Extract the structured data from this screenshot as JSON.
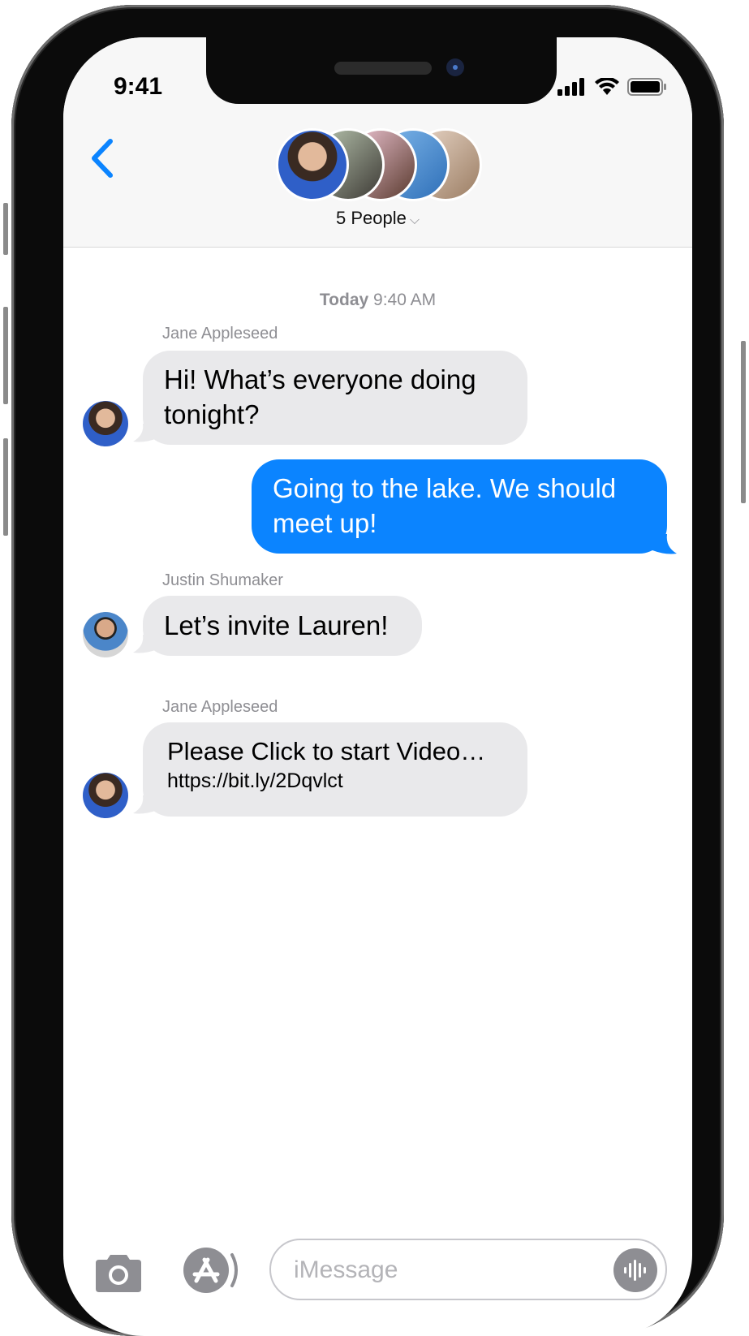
{
  "status_bar": {
    "time": "9:41",
    "icons": [
      "cellular-signal-icon",
      "wifi-icon",
      "battery-icon"
    ]
  },
  "header": {
    "back_icon": "chevron-left-icon",
    "group_label": "5 People",
    "group_chevron": "⌵",
    "avatar_count": 5
  },
  "conversation": {
    "timestamp_day": "Today",
    "timestamp_time": "9:40 AM",
    "messages": [
      {
        "sender": "Jane Appleseed",
        "direction": "incoming",
        "text_lines": [
          "Hi! What’s everyone doing",
          "tonight?"
        ]
      },
      {
        "sender": "",
        "direction": "outgoing",
        "text_lines": [
          "Going to the lake. We should",
          "meet up!"
        ]
      },
      {
        "sender": "Justin Shumaker",
        "direction": "incoming",
        "text_lines": [
          "Let’s invite Lauren!"
        ]
      },
      {
        "sender": "Jane Appleseed",
        "direction": "incoming",
        "text": "Please Click to start Video…",
        "link": "https://bit.ly/2Dqvlct"
      }
    ]
  },
  "input_bar": {
    "camera_icon": "camera-icon",
    "apps_icon": "app-store-icon",
    "placeholder": "iMessage",
    "audio_icon": "audio-waveform-icon"
  },
  "colors": {
    "accent_blue": "#0b84ff",
    "incoming_bubble": "#e9e9eb",
    "secondary_text": "#8e8e93",
    "header_bg": "#f7f7f7"
  }
}
